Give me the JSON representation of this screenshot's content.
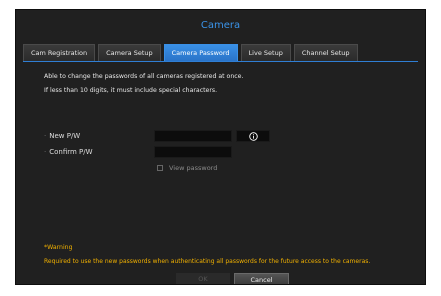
{
  "dialog": {
    "title": "Camera"
  },
  "tabs": [
    {
      "label": "Cam Registration",
      "active": false
    },
    {
      "label": "Camera Setup",
      "active": false
    },
    {
      "label": "Camera Password",
      "active": true
    },
    {
      "label": "Live Setup",
      "active": false
    },
    {
      "label": "Channel Setup",
      "active": false
    }
  ],
  "description": {
    "line1": "Able to change the passwords of all cameras registered at once.",
    "line2": "If less than 10 digits, it must include special characters."
  },
  "form": {
    "new_pw_label": "New P/W",
    "new_pw_value": "",
    "confirm_pw_label": "Confirm P/W",
    "confirm_pw_value": "",
    "view_password_label": "View password",
    "view_password_checked": false,
    "info_icon": "info-icon"
  },
  "warning": {
    "title": "*Warning",
    "text": "Required to use the new passwords when authenticating all passwords for the future access to the cameras."
  },
  "buttons": {
    "ok_label": "OK",
    "cancel_label": "Cancel"
  },
  "colors": {
    "accent": "#3a90e6",
    "warning": "#f0b000",
    "background": "#202020"
  }
}
